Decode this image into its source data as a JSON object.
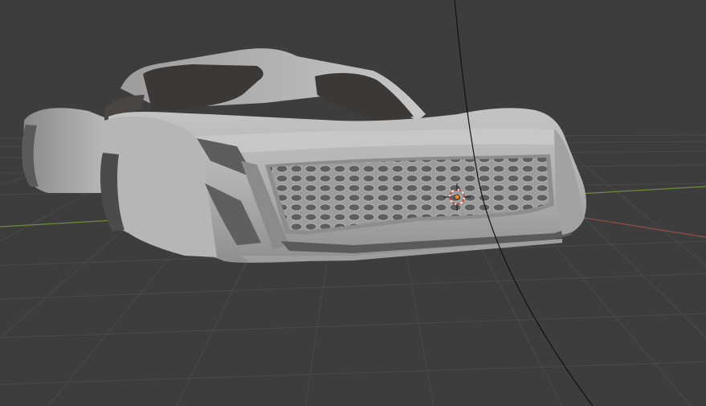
{
  "viewport": {
    "background": "#3d3d3d",
    "grid_color": "#4a4a4a",
    "x_axis_color": "#9a4b4f",
    "y_axis_color": "#6f8b3c",
    "object": "sports-car-body-mesh",
    "object_color": "#a9a9a9",
    "origin_marker": "3d-cursor"
  }
}
